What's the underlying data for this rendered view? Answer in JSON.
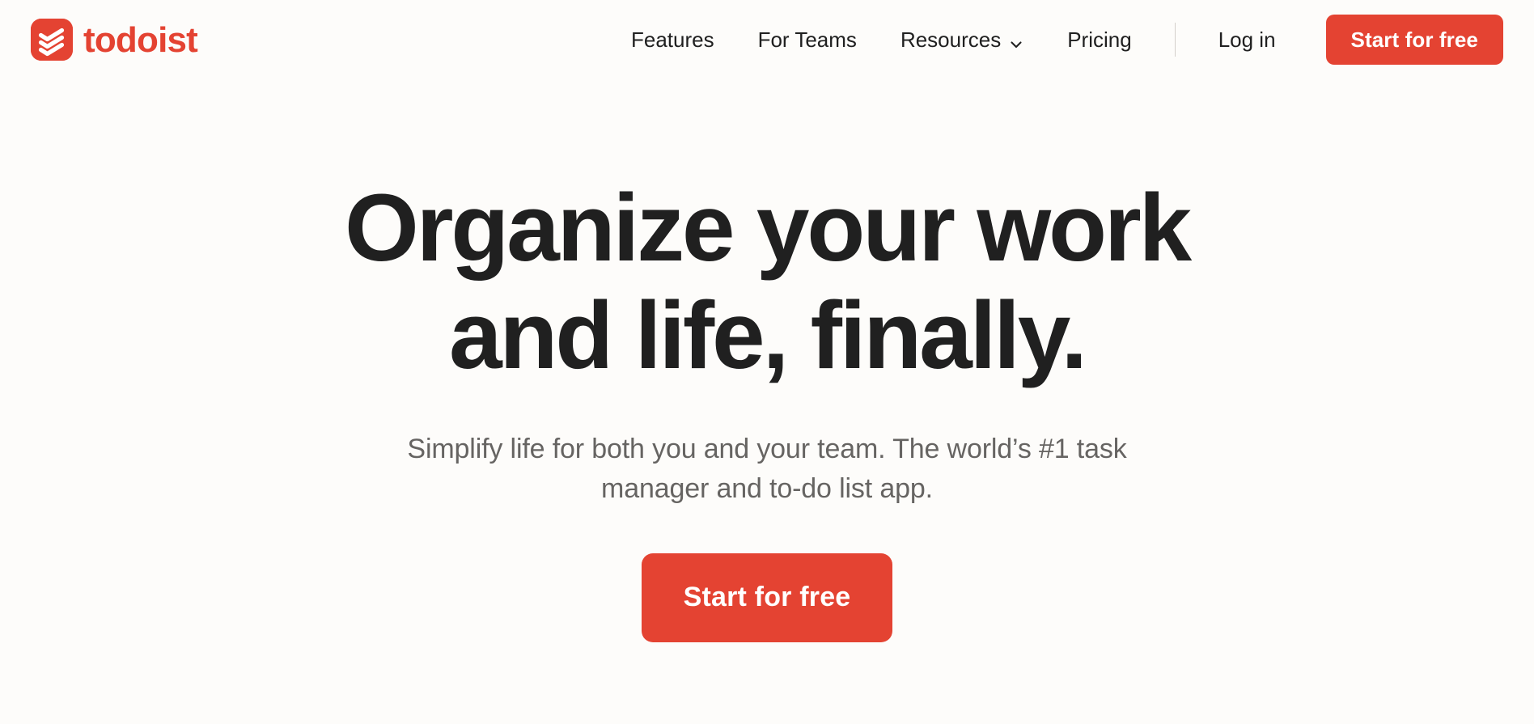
{
  "theme": {
    "background": "#fdfcfa",
    "brand_red": "#e44332",
    "text_dark": "#202020",
    "text_muted": "#666462",
    "divider": "#d4d0cb"
  },
  "header": {
    "brand": {
      "logo_icon": "todoist-logo-mark",
      "wordmark": "todoist"
    },
    "nav_items": [
      {
        "label": "Features",
        "has_dropdown": false
      },
      {
        "label": "For Teams",
        "has_dropdown": false
      },
      {
        "label": "Resources",
        "has_dropdown": true,
        "dropdown_icon": "chevron-down-icon"
      },
      {
        "label": "Pricing",
        "has_dropdown": false
      }
    ],
    "login_label": "Log in",
    "cta_label": "Start for free"
  },
  "hero": {
    "title_line_1": "Organize your work",
    "title_line_2": "and life, finally.",
    "subtitle": "Simplify life for both you and your team. The world’s #1 task manager and to-do list app.",
    "cta_label": "Start for free"
  }
}
